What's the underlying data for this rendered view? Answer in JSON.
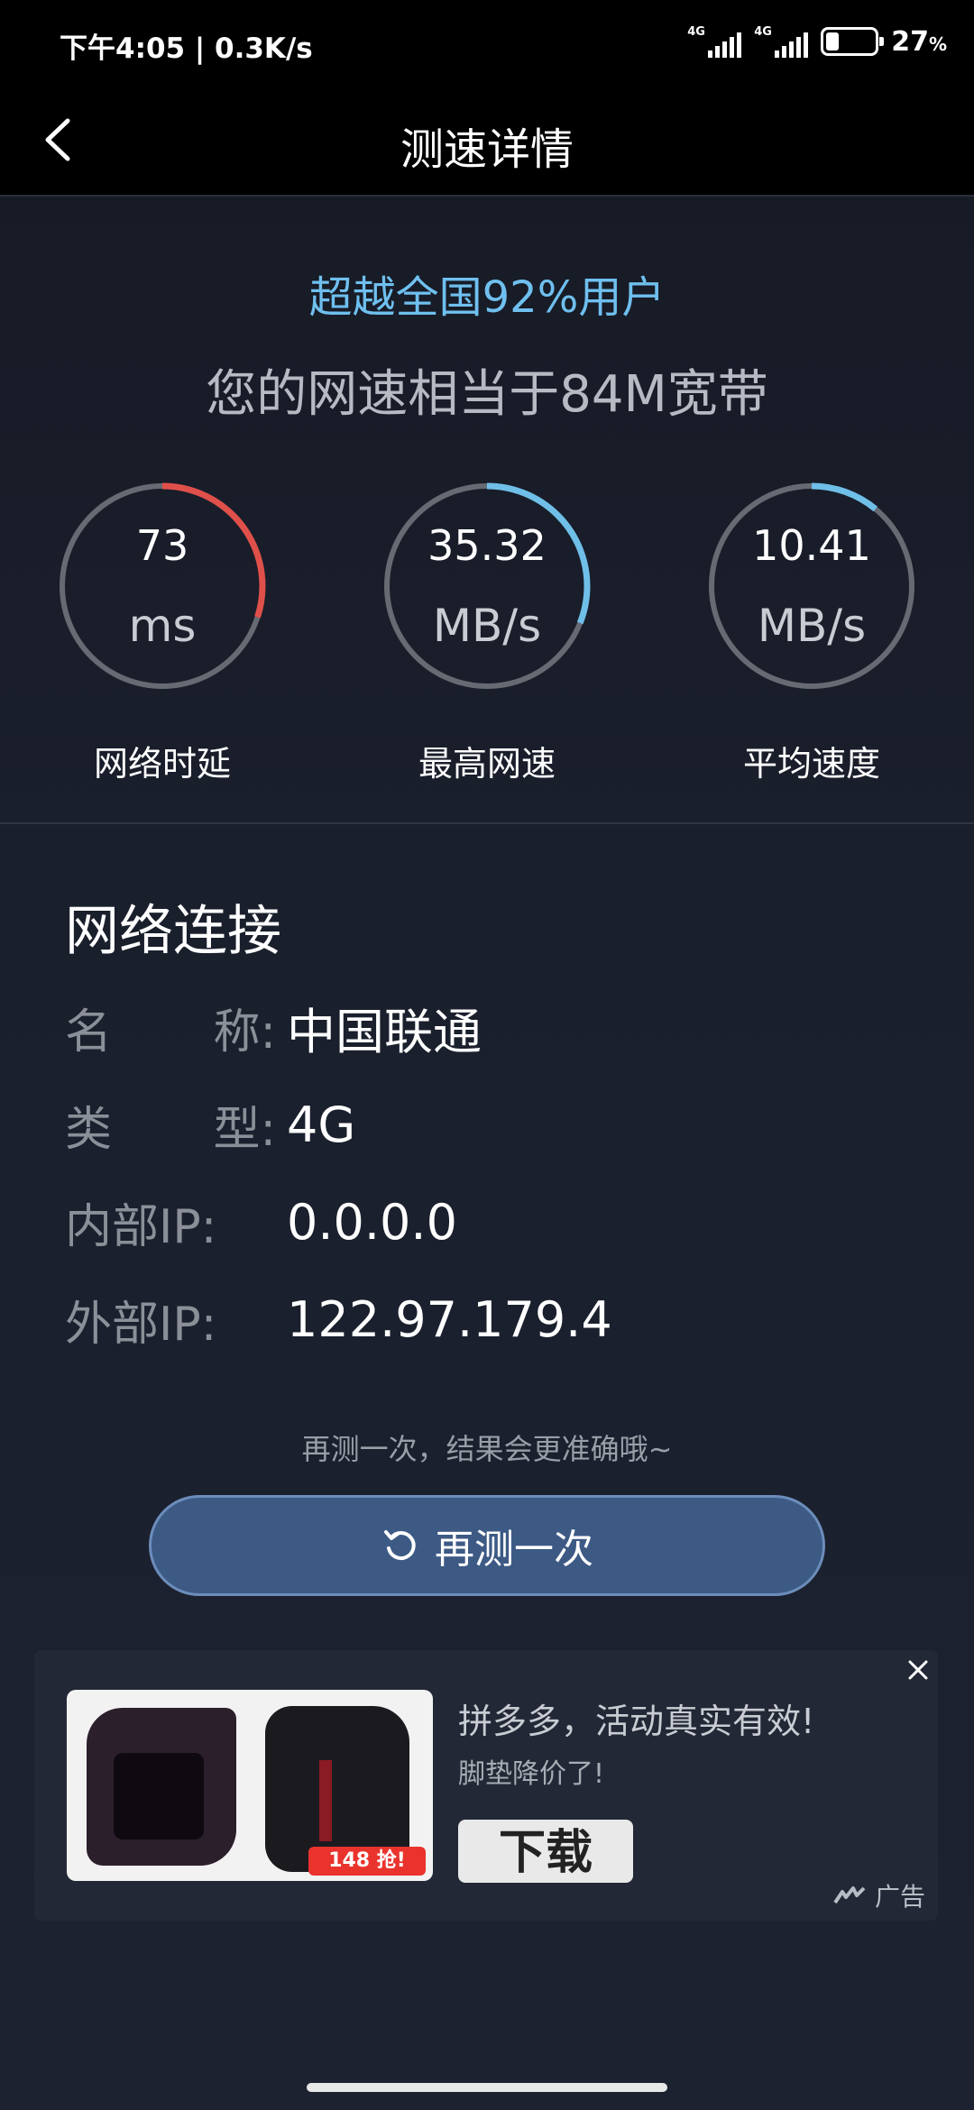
{
  "status_bar": {
    "time_speed": "下午4:05 | 0.3K/s",
    "signal_1": "4G",
    "signal_2": "4G",
    "battery_percent": "27",
    "battery_unit": "%",
    "battery_level": 0.27
  },
  "header": {
    "title": "测速详情"
  },
  "result": {
    "rank_text": "超越全国92%用户",
    "equivalent_text": "您的网速相当于84M宽带"
  },
  "gauges": [
    {
      "value": "73",
      "unit": "ms",
      "label": "网络时延",
      "fraction": 0.3,
      "color": "#e0504b"
    },
    {
      "value": "35.32",
      "unit": "MB/s",
      "label": "最高网速",
      "fraction": 0.31,
      "color": "#6fbfe8"
    },
    {
      "value": "10.41",
      "unit": "MB/s",
      "label": "平均速度",
      "fraction": 0.11,
      "color": "#6fbfe8"
    }
  ],
  "network": {
    "title": "网络连接",
    "rows": [
      {
        "key_a": "名",
        "key_b": "称:",
        "value": "中国联通"
      },
      {
        "key_a": "类",
        "key_b": "型:",
        "value": "4G"
      },
      {
        "key": "内部IP:",
        "value": "0.0.0.0"
      },
      {
        "key": "外部IP:",
        "value": "122.97.179.4"
      }
    ]
  },
  "retest": {
    "hint": "再测一次，结果会更准确哦~",
    "button_label": "再测一次"
  },
  "ad": {
    "title": "拼多多，活动真实有效!",
    "subtitle": "脚垫降价了!",
    "price_badge": "148 抢!",
    "download_label": "下载",
    "ad_mark": "广告"
  },
  "colors": {
    "accent_blue": "#6fc0ef",
    "latency_red": "#e0504b",
    "button_bg": "#3d5a85"
  }
}
